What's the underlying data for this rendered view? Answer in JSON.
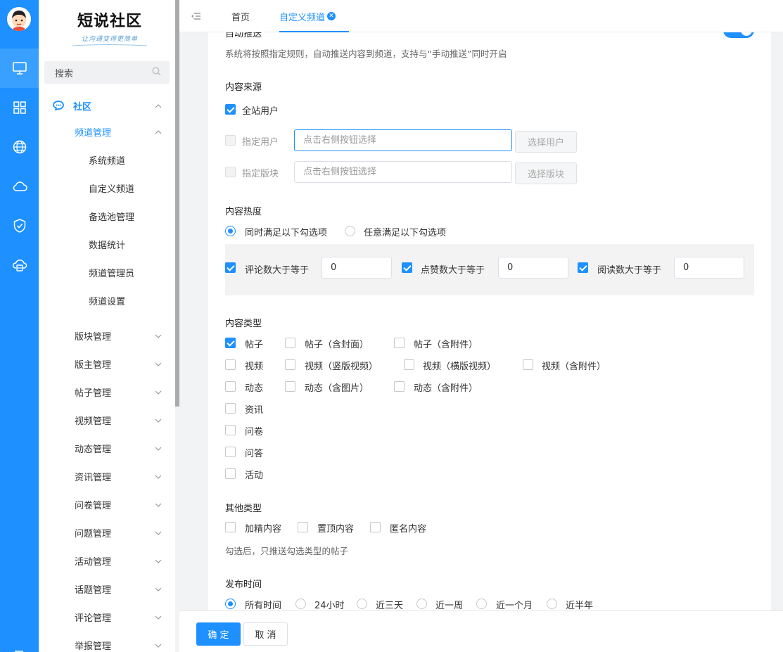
{
  "colors": {
    "accent": "#1e90ff",
    "rail": "#1e90ff",
    "rail_active": "#3aa0ff"
  },
  "rail": {
    "icons": [
      "user-avatar",
      "monitor-icon",
      "grid-icon",
      "globe-icon",
      "cloud-icon",
      "shield-icon",
      "cloud-database-icon",
      "menu-icon"
    ]
  },
  "sidebar": {
    "logo_title": "短说社区",
    "logo_subtitle": "让沟通变得更简单",
    "search_placeholder": "搜索",
    "community_label": "社区",
    "channel_mgmt_label": "频道管理",
    "channel_sub_items": [
      "系统频道",
      "自定义频道",
      "备选池管理",
      "数据统计",
      "频道管理员",
      "频道设置"
    ],
    "items": [
      "版块管理",
      "版主管理",
      "帖子管理",
      "视频管理",
      "动态管理",
      "资讯管理",
      "问卷管理",
      "问题管理",
      "活动管理",
      "话题管理",
      "评论管理",
      "举报管理"
    ]
  },
  "topbar": {
    "tabs": [
      {
        "label": "首页"
      },
      {
        "label": "自定义频道"
      }
    ]
  },
  "form": {
    "auto_push_label": "自动推送",
    "auto_push_enabled": true,
    "auto_push_hint": "系统将按照指定规则，自动推送内容到频道，支持与“手动推送”同时开启",
    "source": {
      "title": "内容来源",
      "all_users_label": "全站用户",
      "all_users_checked": true,
      "specified_users_label": "指定用户",
      "specified_users_placeholder": "点击右侧按钮选择",
      "select_users_button": "选择用户",
      "specified_board_label": "指定版块",
      "specified_board_placeholder": "点击右侧按钮选择",
      "select_board_button": "选择版块"
    },
    "heat": {
      "title": "内容热度",
      "mode_all": "同时满足以下勾选项",
      "mode_any": "任意满足以下勾选项",
      "selected_mode": "all",
      "comments_label": "评论数大于等于",
      "comments_value": "0",
      "likes_label": "点赞数大于等于",
      "likes_value": "0",
      "views_label": "阅读数大于等于",
      "views_value": "0"
    },
    "types": {
      "title": "内容类型",
      "row1": [
        "帖子",
        "帖子（含封面）",
        "帖子（含附件）"
      ],
      "row2": [
        "视频",
        "视频（竖版视频）",
        "视频（横版视频）",
        "视频（含附件）"
      ],
      "row3": [
        "动态",
        "动态（含图片）",
        "动态（含附件）"
      ],
      "singles": [
        "资讯",
        "问卷",
        "问答",
        "活动"
      ]
    },
    "other_types": {
      "title": "其他类型",
      "items": [
        "加精内容",
        "置顶内容",
        "匿名内容"
      ],
      "hint": "勾选后，只推送勾选类型的帖子"
    },
    "publish_time": {
      "title": "发布时间",
      "options": [
        "所有时间",
        "24小时",
        "近三天",
        "近一周",
        "近一个月",
        "近半年"
      ],
      "selected": "所有时间"
    }
  },
  "footer": {
    "confirm_label": "确 定",
    "cancel_label": "取 消"
  }
}
